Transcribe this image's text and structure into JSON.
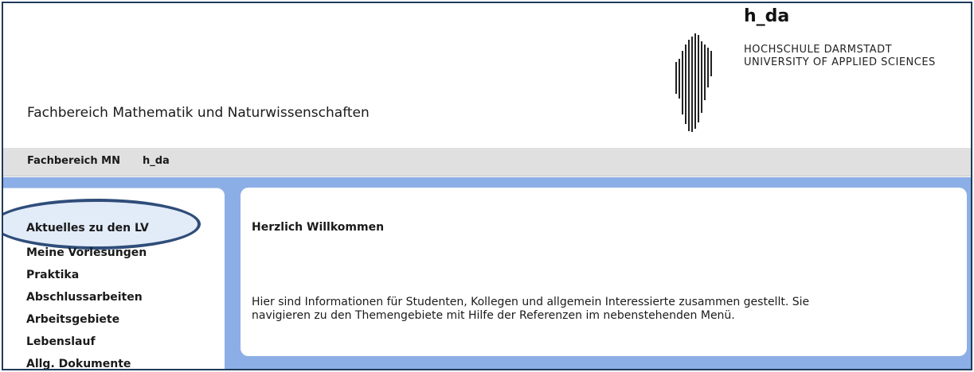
{
  "header": {
    "department_title": "Fachbereich Mathematik und Naturwissenschaften",
    "logo": {
      "brand": "h_da",
      "line1": "HOCHSCHULE DARMSTADT",
      "line2": "UNIVERSITY OF APPLIED SCIENCES"
    }
  },
  "navbar": {
    "items": [
      "Fachbereich MN",
      "h_da"
    ]
  },
  "sidebar": {
    "items": [
      "Aktuelles zu den LV",
      "Meine Vorlesungen",
      "Praktika",
      "Abschlussarbeiten",
      "Arbeitsgebiete",
      "Lebenslauf",
      "Allg. Dokumente"
    ],
    "highlighted_item": "Aktuelles zu den LV"
  },
  "content": {
    "heading": "Herzlich Willkommen",
    "line1": "Hier sind Informationen für Studenten, Kollegen und allgemein Interessierte zusammen gestellt. Sie",
    "line2": "navigieren zu den Themengebiete mit Hilfe der Referenzen im nebenstehenden Menü."
  },
  "colors": {
    "accent_blue": "#8caee6",
    "navbar_gray": "#e0e0e0",
    "annotation_oval": "#2f4d7a"
  }
}
